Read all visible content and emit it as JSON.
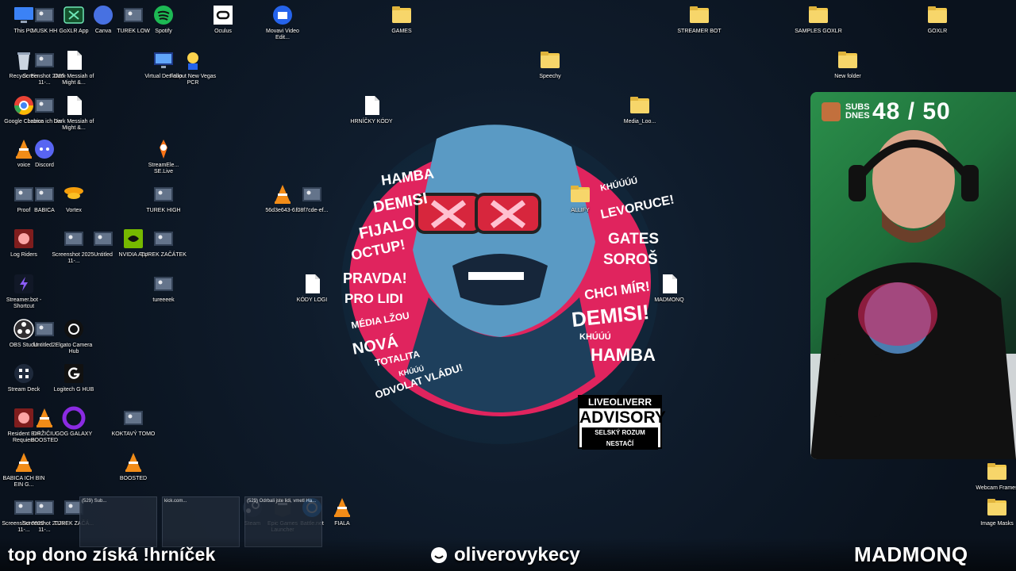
{
  "desktop": {
    "icons": [
      {
        "id": "this-pc",
        "label": "This PC",
        "icon": "computer-icon"
      },
      {
        "id": "musk-hh",
        "label": "MUSK HH",
        "icon": "image-icon"
      },
      {
        "id": "goxlr-app",
        "label": "GoXLR App",
        "icon": "goxlr-icon"
      },
      {
        "id": "canva",
        "label": "Canva",
        "icon": "canva-icon"
      },
      {
        "id": "turek-low",
        "label": "TUREK LOW",
        "icon": "image-icon"
      },
      {
        "id": "spotify",
        "label": "Spotify",
        "icon": "spotify-icon"
      },
      {
        "id": "oculus",
        "label": "Oculus",
        "icon": "oculus-icon"
      },
      {
        "id": "movavi",
        "label": "Movavi Video Edit...",
        "icon": "movavi-icon"
      },
      {
        "id": "games",
        "label": "GAMES",
        "icon": "folder-icon"
      },
      {
        "id": "streamer-bot-folder",
        "label": "STREAMER BOT",
        "icon": "folder-icon"
      },
      {
        "id": "samples-goxlr",
        "label": "SAMPLES GOXLR",
        "icon": "folder-icon"
      },
      {
        "id": "goxlr-folder",
        "label": "GOXLR",
        "icon": "folder-icon"
      },
      {
        "id": "recycle-bin",
        "label": "Recycle Bin",
        "icon": "recycle-bin-icon"
      },
      {
        "id": "screenshot-1",
        "label": "Screenshot 2025-11-...",
        "icon": "image-icon"
      },
      {
        "id": "dark-messiah-1",
        "label": "Dark Messiah of Might &...",
        "icon": "file-icon"
      },
      {
        "id": "virtual-desktop",
        "label": "Virtual Desktop",
        "icon": "monitor-icon"
      },
      {
        "id": "fallout",
        "label": "Fallout New Vegas PCR",
        "icon": "fallout-icon"
      },
      {
        "id": "speechy",
        "label": "Speechy",
        "icon": "folder-icon"
      },
      {
        "id": "new-folder",
        "label": "New folder",
        "icon": "folder-icon"
      },
      {
        "id": "google-chrome",
        "label": "Google Chrome",
        "icon": "chrome-icon"
      },
      {
        "id": "babica-ich-bin",
        "label": "babica ich bin",
        "icon": "image-icon"
      },
      {
        "id": "dark-messiah-2",
        "label": "Dark Messiah of Might &...",
        "icon": "file-icon"
      },
      {
        "id": "hrnicky-kody",
        "label": "HRNÍČKY KÓDY",
        "icon": "file-icon"
      },
      {
        "id": "media-loo",
        "label": "Media_Loo...",
        "icon": "folder-icon"
      },
      {
        "id": "voice",
        "label": "voice",
        "icon": "vlc-icon"
      },
      {
        "id": "discord",
        "label": "Discord",
        "icon": "discord-icon"
      },
      {
        "id": "streamelements",
        "label": "StreamEle... SE.Live",
        "icon": "streamelements-icon"
      },
      {
        "id": "proof",
        "label": "Proof",
        "icon": "image-icon"
      },
      {
        "id": "babica",
        "label": "BABICA",
        "icon": "image-icon"
      },
      {
        "id": "vortex",
        "label": "Vortex",
        "icon": "vortex-icon"
      },
      {
        "id": "turek-high",
        "label": "TUREK HIGH",
        "icon": "image-icon"
      },
      {
        "id": "vlc-file",
        "label": "56d3e643-6...",
        "icon": "vlc-icon"
      },
      {
        "id": "f08f7cde",
        "label": "f08f7cde-ef...",
        "icon": "image-icon"
      },
      {
        "id": "allify",
        "label": "ALLIFY",
        "icon": "folder-icon"
      },
      {
        "id": "log-riders",
        "label": "Log Riders",
        "icon": "game-icon"
      },
      {
        "id": "screenshot-2",
        "label": "Screenshot 2025-11-...",
        "icon": "image-icon"
      },
      {
        "id": "untitled",
        "label": "Untitled",
        "icon": "image-icon"
      },
      {
        "id": "nvidia-app",
        "label": "NVIDIA App",
        "icon": "nvidia-icon"
      },
      {
        "id": "turek-zacatek",
        "label": "TUREK ZAČÁTEK",
        "icon": "image-icon"
      },
      {
        "id": "streamer-bot",
        "label": "Streamer.bot - Shortcut",
        "icon": "streamerbot-icon"
      },
      {
        "id": "kody-logi",
        "label": "KÓDY LOGI",
        "icon": "file-icon"
      },
      {
        "id": "madmonq-file",
        "label": "MADMONQ",
        "icon": "file-icon"
      },
      {
        "id": "tureeeek",
        "label": "tureeeek",
        "icon": "image-icon"
      },
      {
        "id": "obs-studio",
        "label": "OBS Studio",
        "icon": "obs-icon"
      },
      {
        "id": "untitled2",
        "label": "Untitled2",
        "icon": "image-icon"
      },
      {
        "id": "elgato",
        "label": "Elgato Camera Hub",
        "icon": "camera-icon"
      },
      {
        "id": "stream-deck",
        "label": "Stream Deck",
        "icon": "streamdeck-icon"
      },
      {
        "id": "logitech",
        "label": "Logitech G HUB",
        "icon": "logitech-icon"
      },
      {
        "id": "resident-evil",
        "label": "Resident Evil Requiem",
        "icon": "game-icon"
      },
      {
        "id": "drziciu",
        "label": "DRŽIČIU BOOSTED",
        "icon": "vlc-icon"
      },
      {
        "id": "gog-galaxy",
        "label": "GOG GALAXY",
        "icon": "gog-icon"
      },
      {
        "id": "koktavy-tomo",
        "label": "KOKTAVÝ TOMO",
        "icon": "image-icon"
      },
      {
        "id": "babica-ich-bin-ein",
        "label": "BABICA ICH BIN EIN G...",
        "icon": "vlc-icon"
      },
      {
        "id": "boosted",
        "label": "BOOSTED",
        "icon": "vlc-icon"
      },
      {
        "id": "webcam-frames",
        "label": "Webcam Frames",
        "icon": "folder-icon"
      },
      {
        "id": "screenshot-3",
        "label": "Screenshot 2025-11-...",
        "icon": "image-icon"
      },
      {
        "id": "screenshot-4",
        "label": "Screenshot 2025-11-...",
        "icon": "image-icon"
      },
      {
        "id": "turek-zacatek-2",
        "label": "TUREK ZAČÁ...",
        "icon": "image-icon"
      },
      {
        "id": "steam",
        "label": "Steam",
        "icon": "steam-icon"
      },
      {
        "id": "epic",
        "label": "Epic Games Launcher",
        "icon": "epic-icon"
      },
      {
        "id": "battlenet",
        "label": "Battle.net",
        "icon": "battlenet-icon"
      },
      {
        "id": "fiala",
        "label": "FIALA",
        "icon": "vlc-icon"
      },
      {
        "id": "image-masks",
        "label": "Image Masks",
        "icon": "folder-icon"
      }
    ]
  },
  "taskbar_thumbs": [
    {
      "title": "(529) Sub..."
    },
    {
      "title": "kick.com..."
    },
    {
      "title": "(529) Odrbali jste lidi, vmetl Ha..."
    }
  ],
  "center_art": {
    "left_words": [
      "HAMBA",
      "DEMISI",
      "FIJALO",
      "OCTUP!",
      "PRAVDA!",
      "PRO LIDI",
      "MÉDIA LŽOU",
      "NOVÁ",
      "TOTALITA",
      "KHÚÚÚ",
      "ODVOLAT VLÁDU!"
    ],
    "right_words": [
      "KHÚÚÚÚ",
      "LEVORUCE!",
      "GATES",
      "SOROŠ",
      "CHCI MÍR!",
      "DEMISI!",
      "KHÚÚÚ",
      "HAMBA"
    ],
    "advisory": {
      "top": "LIVEOLIVERR",
      "middle": "ADVISORY",
      "bottom": "SELSKÝ ROZUM NESTAČÍ"
    }
  },
  "webcam": {
    "subs_label": "SUBS DNES",
    "subs_count": "48 / 50"
  },
  "overlay": {
    "left_text": "top dono získá !hrníček",
    "channel_name": "oliverovykecy",
    "sponsor": "MADMONQ"
  },
  "colors": {
    "accent_pink": "#e0245e",
    "webcam_green": "#2b8f4b",
    "folder_yellow": "#f2c94c"
  }
}
